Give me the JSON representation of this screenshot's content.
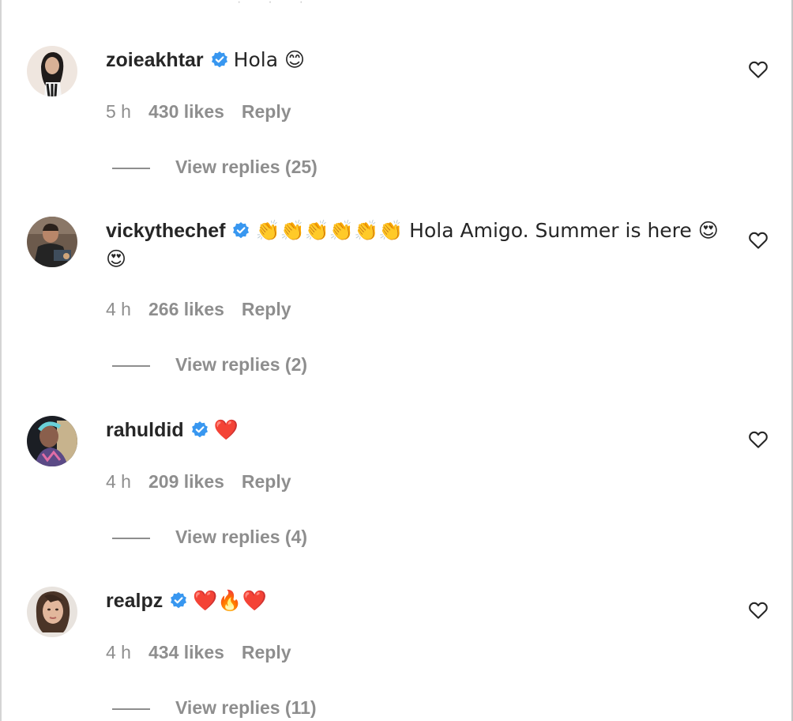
{
  "comments": [
    {
      "username": "zoieakhtar",
      "verified": true,
      "text": "Hola 😊",
      "time": "5 h",
      "likes": "430 likes",
      "reply_label": "Reply",
      "replies_label": "View replies (25)"
    },
    {
      "username": "vickythechef",
      "verified": true,
      "text": "👏👏👏👏👏👏 Hola Amigo. Summer is here 😍😍",
      "time": "4 h",
      "likes": "266 likes",
      "reply_label": "Reply",
      "replies_label": "View replies (2)"
    },
    {
      "username": "rahuldid",
      "verified": true,
      "text": "❤️",
      "time": "4 h",
      "likes": "209 likes",
      "reply_label": "Reply",
      "replies_label": "View replies (4)"
    },
    {
      "username": "realpz",
      "verified": true,
      "text": "❤️🔥❤️",
      "time": "4 h",
      "likes": "434 likes",
      "reply_label": "Reply",
      "replies_label": "View replies (11)"
    }
  ],
  "icons": {
    "verified": "verified-badge-icon",
    "like": "heart-outline-icon"
  },
  "colors": {
    "verified": "#3897f0",
    "text": "#262626",
    "muted": "#8e8e8e"
  }
}
